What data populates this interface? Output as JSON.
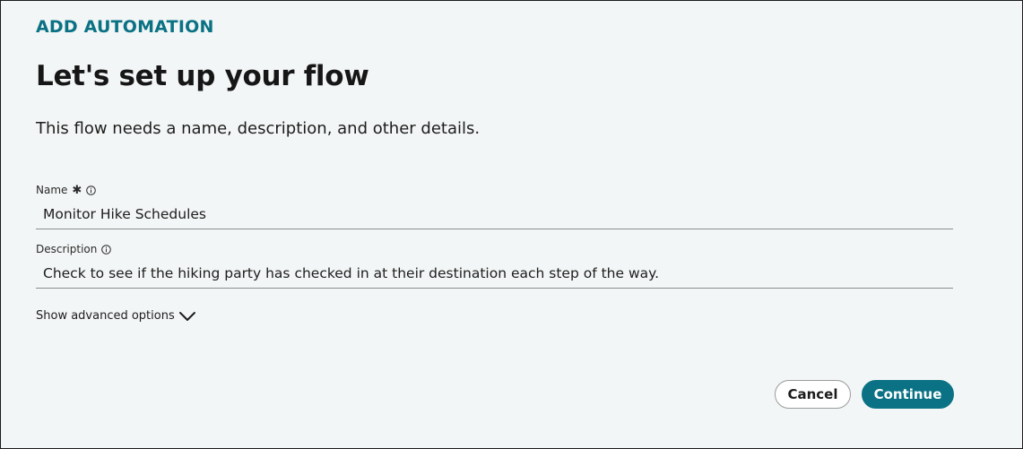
{
  "header": {
    "eyebrow": "ADD AUTOMATION",
    "title": "Let's set up your flow",
    "subtitle": "This flow needs a name, description, and other details."
  },
  "form": {
    "name": {
      "label": "Name",
      "required_marker": "✱",
      "value": "Monitor Hike Schedules",
      "info_icon": "info-icon"
    },
    "description": {
      "label": "Description",
      "value": "Check to see if the hiking party has checked in at their destination each step of the way.",
      "info_icon": "info-icon"
    },
    "advanced_toggle": {
      "label": "Show advanced options",
      "icon": "chevron-down-icon"
    }
  },
  "actions": {
    "cancel_label": "Cancel",
    "continue_label": "Continue"
  },
  "colors": {
    "accent": "#0a7284",
    "background": "#f3f6f6",
    "text": "#181818"
  }
}
